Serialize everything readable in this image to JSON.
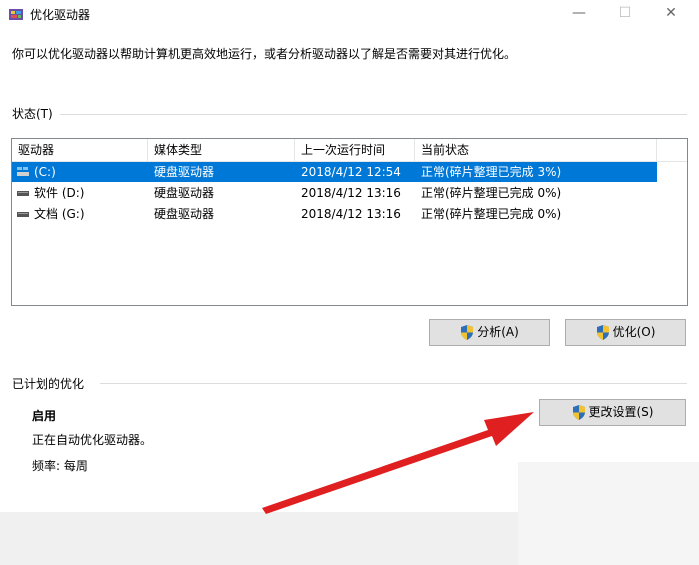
{
  "window": {
    "title": "优化驱动器",
    "minimize_glyph": "—",
    "maximize_glyph": "☐",
    "close_glyph": "✕",
    "icon": "defrag-app-icon"
  },
  "description": "你可以优化驱动器以帮助计算机更高效地运行，或者分析驱动器以了解是否需要对其进行优化。",
  "status_section": {
    "label": "状态(T)",
    "columns": [
      "驱动器",
      "媒体类型",
      "上一次运行时间",
      "当前状态"
    ],
    "rows": [
      {
        "drive": "(C:)",
        "media": "硬盘驱动器",
        "last_run": "2018/4/12 12:54",
        "status": "正常(碎片整理已完成 3%)",
        "selected": true,
        "icon": "system-drive-icon"
      },
      {
        "drive": "软件 (D:)",
        "media": "硬盘驱动器",
        "last_run": "2018/4/12 13:16",
        "status": "正常(碎片整理已完成 0%)",
        "selected": false,
        "icon": "hard-drive-icon"
      },
      {
        "drive": "文档 (G:)",
        "media": "硬盘驱动器",
        "last_run": "2018/4/12 13:16",
        "status": "正常(碎片整理已完成 0%)",
        "selected": false,
        "icon": "hard-drive-icon"
      }
    ]
  },
  "buttons": {
    "analyze": "分析(A)",
    "optimize": "优化(O)",
    "change_settings": "更改设置(S)"
  },
  "scheduled": {
    "label": "已计划的优化",
    "status": "启用",
    "detail": "正在自动优化驱动器。",
    "frequency": "频率: 每周"
  },
  "colors": {
    "selection": "#0078d7",
    "arrow": "#e02020",
    "shield_blue": "#2f6fb7",
    "shield_yellow": "#f2c230"
  }
}
